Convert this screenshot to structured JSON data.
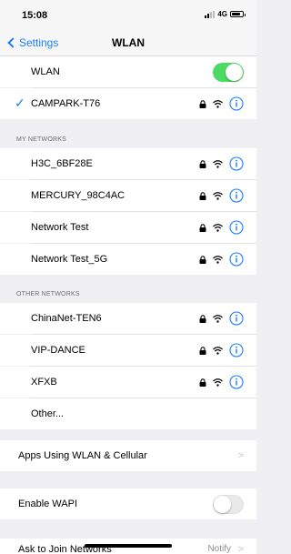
{
  "status": {
    "time": "15:08",
    "network": "4G"
  },
  "nav": {
    "back_label": "Settings",
    "title": "WLAN"
  },
  "wlan": {
    "label": "WLAN",
    "enabled": true
  },
  "current_network": {
    "name": "CAMPARK-T76",
    "connected": true
  },
  "my_networks": {
    "header": "MY NETWORKS",
    "items": [
      {
        "name": "H3C_6BF28E"
      },
      {
        "name": "MERCURY_98C4AC"
      },
      {
        "name": "Network Test"
      },
      {
        "name": "Network Test_5G"
      }
    ]
  },
  "other_networks": {
    "header": "OTHER NETWORKS",
    "items": [
      {
        "name": "ChinaNet-TEN6"
      },
      {
        "name": "VIP-DANCE"
      },
      {
        "name": "XFXB"
      }
    ],
    "other_label": "Other..."
  },
  "apps_row": {
    "label": "Apps Using WLAN & Cellular"
  },
  "wapi_row": {
    "label": "Enable WAPI",
    "enabled": false
  },
  "ask_row": {
    "label": "Ask to Join Networks",
    "value": "Notify"
  },
  "colors": {
    "accent": "#1a7dfc",
    "toggle_on": "#4cd964",
    "background": "#efeff4"
  },
  "icons": [
    "lock-icon",
    "wifi-icon",
    "info-icon",
    "checkmark-icon",
    "chevron-right-icon"
  ]
}
